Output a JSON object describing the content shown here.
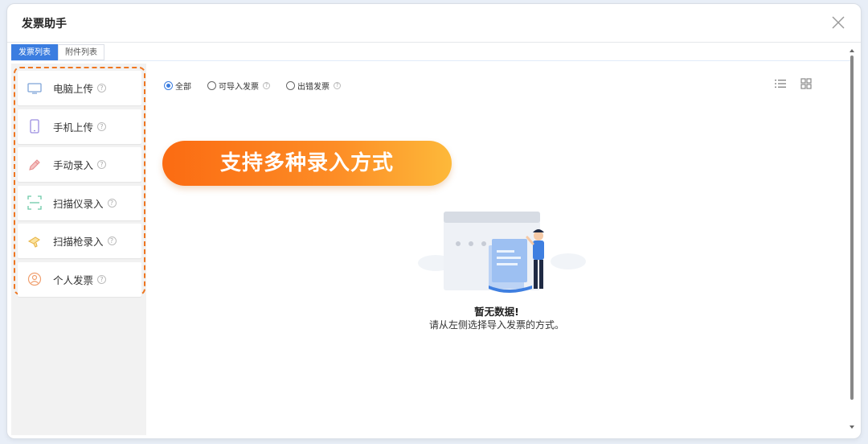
{
  "window": {
    "title": "发票助手"
  },
  "tabs": [
    {
      "label": "发票列表",
      "active": true
    },
    {
      "label": "附件列表",
      "active": false
    }
  ],
  "sidebar": {
    "items": [
      {
        "label": "电脑上传",
        "icon": "monitor-icon"
      },
      {
        "label": "手机上传",
        "icon": "phone-icon"
      },
      {
        "label": "手动录入",
        "icon": "pen-icon"
      },
      {
        "label": "扫描仪录入",
        "icon": "scanner-icon"
      },
      {
        "label": "扫描枪录入",
        "icon": "scan-gun-icon"
      },
      {
        "label": "个人发票",
        "icon": "user-icon"
      }
    ],
    "help_glyph": "?"
  },
  "filters": {
    "options": [
      {
        "label": "全部",
        "checked": true
      },
      {
        "label": "可导入发票",
        "checked": false
      },
      {
        "label": "出错发票",
        "checked": false
      }
    ]
  },
  "banner": {
    "text": "支持多种录入方式"
  },
  "empty": {
    "title": "暂无数据!",
    "description": "请从左侧选择导入发票的方式。"
  },
  "colors": {
    "accent": "#3b7de0",
    "highlight_border": "#ee7620",
    "banner_start": "#fb6b12",
    "banner_end": "#fdb93a"
  }
}
